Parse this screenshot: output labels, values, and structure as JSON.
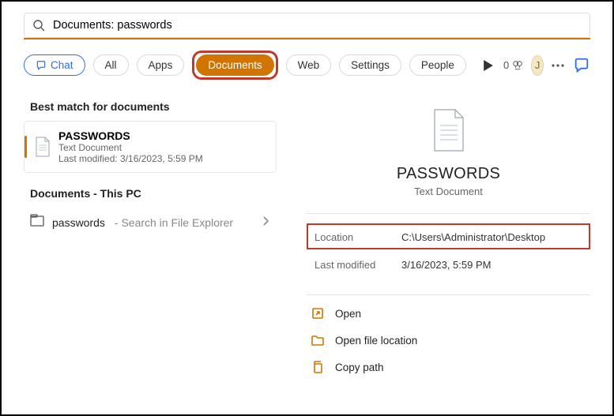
{
  "search": {
    "value": "Documents: passwords"
  },
  "pills": {
    "chat": "Chat",
    "all": "All",
    "apps": "Apps",
    "documents": "Documents",
    "web": "Web",
    "settings": "Settings",
    "people": "People"
  },
  "header": {
    "points": "0",
    "avatar_initial": "J"
  },
  "left": {
    "best_match_title": "Best match for documents",
    "result": {
      "name": "PASSWORDS",
      "type": "Text Document",
      "modified_label": "Last modified: 3/16/2023, 5:59 PM"
    },
    "this_pc_title": "Documents - This PC",
    "explorer": {
      "name": "passwords",
      "suffix": " - Search in File Explorer"
    }
  },
  "preview": {
    "title": "PASSWORDS",
    "subtitle": "Text Document",
    "location_key": "Location",
    "location_val": "C:\\Users\\Administrator\\Desktop",
    "modified_key": "Last modified",
    "modified_val": "3/16/2023, 5:59 PM",
    "actions": {
      "open": "Open",
      "open_loc": "Open file location",
      "copy_path": "Copy path"
    }
  }
}
